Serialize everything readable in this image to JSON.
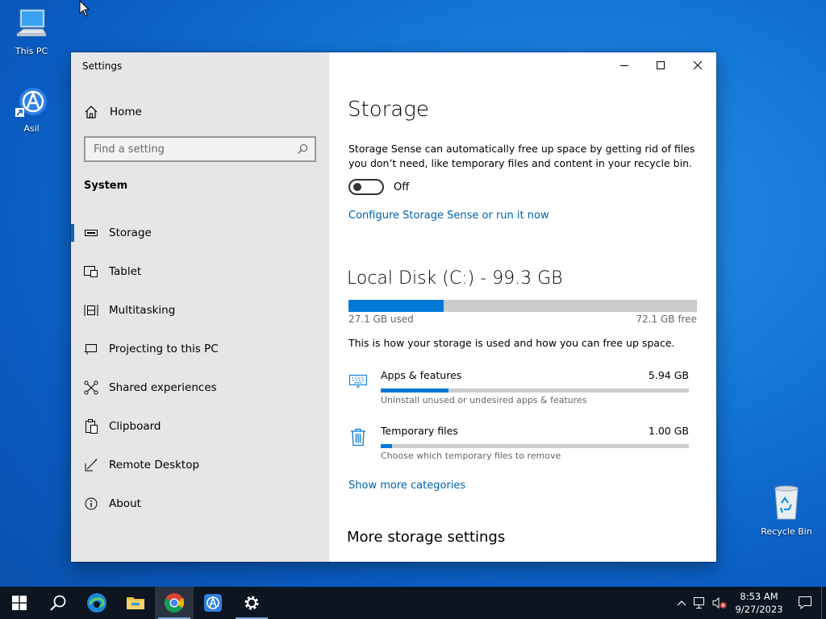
{
  "desktop": {
    "icons": [
      {
        "label": "This PC"
      },
      {
        "label": "Asil"
      },
      {
        "label": "Recycle Bin"
      }
    ]
  },
  "window": {
    "title": "Settings",
    "nav": {
      "home_label": "Home",
      "search_placeholder": "Find a setting",
      "section_heading": "System",
      "items": [
        {
          "label": "Storage",
          "icon": "storage-icon",
          "active": true
        },
        {
          "label": "Tablet",
          "icon": "tablet-icon"
        },
        {
          "label": "Multitasking",
          "icon": "multitasking-icon"
        },
        {
          "label": "Projecting to this PC",
          "icon": "projecting-icon"
        },
        {
          "label": "Shared experiences",
          "icon": "shared-experiences-icon"
        },
        {
          "label": "Clipboard",
          "icon": "clipboard-icon"
        },
        {
          "label": "Remote Desktop",
          "icon": "remote-desktop-icon"
        },
        {
          "label": "About",
          "icon": "info-icon"
        }
      ]
    },
    "content": {
      "title": "Storage",
      "storage_sense_desc": "Storage Sense can automatically free up space by getting rid of files you don’t need, like temporary files and content in your recycle bin.",
      "toggle_state": "Off",
      "configure_link": "Configure Storage Sense or run it now",
      "disk_title": "Local Disk (C:) - 99.3 GB",
      "used_label": "27.1 GB used",
      "free_label": "72.1 GB free",
      "used_fraction": 0.273,
      "explain": "This is how your storage is used and how you can free up space.",
      "categories": [
        {
          "name": "Apps & features",
          "size": "5.94 GB",
          "desc": "Uninstall unused or undesired apps & features",
          "fraction": 0.22,
          "icon": "apps-features-icon"
        },
        {
          "name": "Temporary files",
          "size": "1.00 GB",
          "desc": "Choose which temporary files to remove",
          "fraction": 0.037,
          "icon": "trash-icon"
        }
      ],
      "show_more": "Show more categories",
      "more_settings": "More storage settings"
    }
  },
  "taskbar": {
    "time": "8:53 AM",
    "date": "9/27/2023",
    "accent": "#0078d7"
  }
}
